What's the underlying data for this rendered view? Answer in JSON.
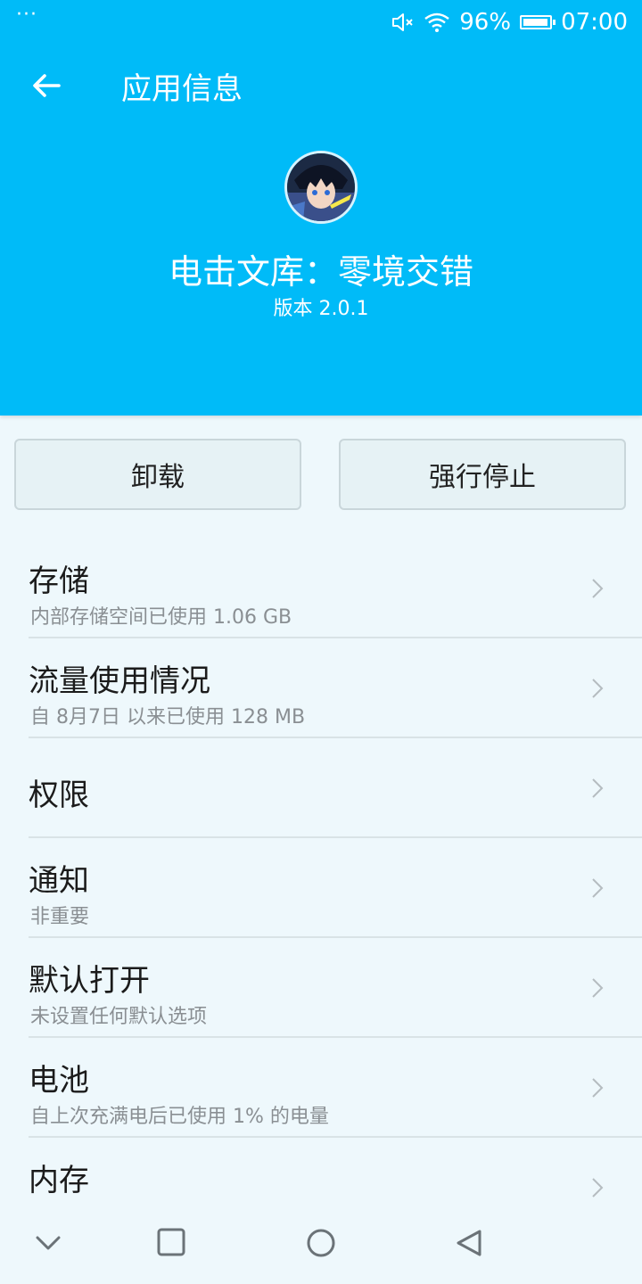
{
  "status_bar": {
    "dots": "···",
    "battery_percent": "96%",
    "battery_level": 0.96,
    "time": "07:00",
    "icons": [
      "mute-icon",
      "wifi-icon",
      "battery-icon"
    ]
  },
  "header": {
    "title": "应用信息",
    "back_icon": "arrow-left-icon",
    "background": "#00bbf8"
  },
  "app": {
    "name": "电击文库：零境交错",
    "version": "版本 2.0.1"
  },
  "actions": {
    "uninstall": "卸载",
    "force_stop": "强行停止"
  },
  "settings": [
    {
      "label": "存储",
      "sub": "内部存储空间已使用 1.06 GB"
    },
    {
      "label": "流量使用情况",
      "sub": "自 8月7日 以来已使用 128 MB"
    },
    {
      "label": "权限",
      "sub": ""
    },
    {
      "label": "通知",
      "sub": "非重要"
    },
    {
      "label": "默认打开",
      "sub": "未设置任何默认选项"
    },
    {
      "label": "电池",
      "sub": "自上次充满电后已使用 1% 的电量"
    },
    {
      "label": "内存",
      "sub": ""
    }
  ],
  "nav": {
    "icons": [
      "collapse-down-icon",
      "recents-square-icon",
      "home-circle-icon",
      "back-triangle-icon"
    ]
  }
}
